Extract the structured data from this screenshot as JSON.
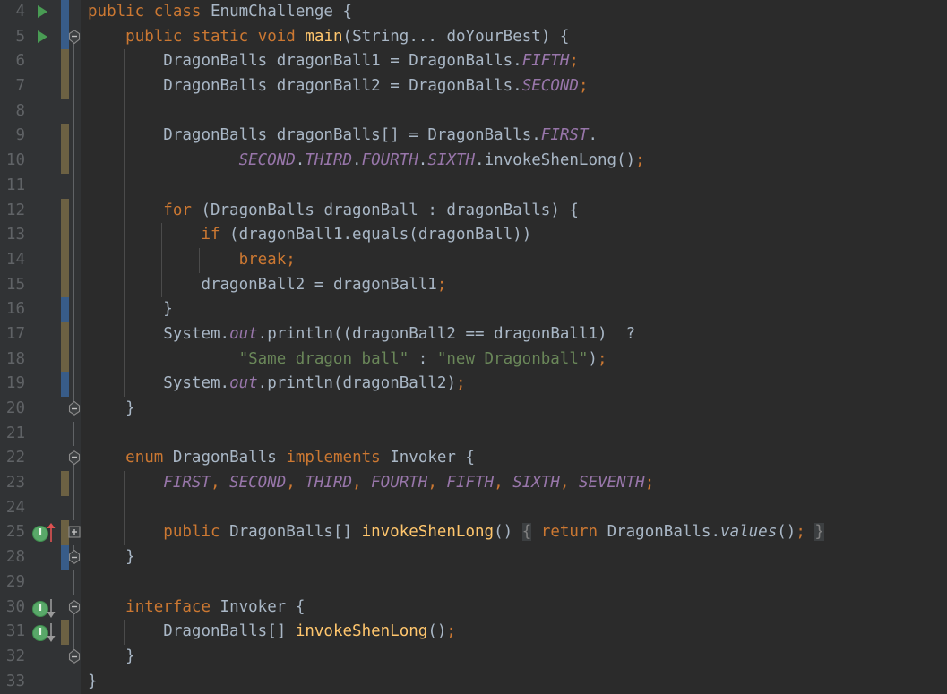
{
  "editor": {
    "app": "intellij-idea-editor",
    "theme": "Darcula",
    "colors": {
      "background": "#2B2B2B",
      "gutter_background": "#313335",
      "line_number": "#606366",
      "keyword": "#CC7832",
      "identifier": "#A9B7C6",
      "method_declaration": "#FFC66D",
      "enum_constant": "#9876AA",
      "string": "#6A8759",
      "vcs_modified": "#6C6143",
      "vcs_added": "#3A6496",
      "run_marker": "#499C54",
      "impl_marker": "#59A869",
      "override_arrow": "#E05252",
      "fold_highlight": "#3C3F41"
    },
    "first_visible_line": 4,
    "last_visible_line": 33
  },
  "lines": [
    {
      "num": "4",
      "indent_guides": [],
      "gutter": {
        "run": true,
        "vcs": "add",
        "fold": "none",
        "impl": "none",
        "arrow": "none"
      },
      "tokens": [
        {
          "t": "public",
          "c": "kw"
        },
        {
          "t": " ",
          "c": "punc"
        },
        {
          "t": "class",
          "c": "kw"
        },
        {
          "t": " ",
          "c": "punc"
        },
        {
          "t": "EnumChallenge",
          "c": "type"
        },
        {
          "t": " ",
          "c": "punc"
        },
        {
          "t": "{",
          "c": "brace"
        }
      ]
    },
    {
      "num": "5",
      "indent_guides": [],
      "gutter": {
        "run": true,
        "vcs": "add",
        "fold": "collapse",
        "impl": "none",
        "arrow": "none"
      },
      "tokens": [
        {
          "t": "    ",
          "c": "punc"
        },
        {
          "t": "public",
          "c": "kw"
        },
        {
          "t": " ",
          "c": "punc"
        },
        {
          "t": "static",
          "c": "kw"
        },
        {
          "t": " ",
          "c": "punc"
        },
        {
          "t": "void",
          "c": "kw"
        },
        {
          "t": " ",
          "c": "punc"
        },
        {
          "t": "main",
          "c": "meth"
        },
        {
          "t": "(",
          "c": "punc"
        },
        {
          "t": "String",
          "c": "type"
        },
        {
          "t": "... ",
          "c": "punc"
        },
        {
          "t": "doYourBest",
          "c": "id"
        },
        {
          "t": ") {",
          "c": "punc"
        }
      ]
    },
    {
      "num": "6",
      "indent_guides": [
        1
      ],
      "gutter": {
        "run": false,
        "vcs": "mod",
        "fold": "line",
        "impl": "none",
        "arrow": "none"
      },
      "tokens": [
        {
          "t": "        ",
          "c": "punc"
        },
        {
          "t": "DragonBalls",
          "c": "type"
        },
        {
          "t": " ",
          "c": "punc"
        },
        {
          "t": "dragonBall1",
          "c": "id"
        },
        {
          "t": " = ",
          "c": "punc"
        },
        {
          "t": "DragonBalls",
          "c": "type"
        },
        {
          "t": ".",
          "c": "punc"
        },
        {
          "t": "FIFTH",
          "c": "enumc"
        },
        {
          "t": ";",
          "c": "orange"
        }
      ]
    },
    {
      "num": "7",
      "indent_guides": [
        1
      ],
      "gutter": {
        "run": false,
        "vcs": "mod",
        "fold": "line",
        "impl": "none",
        "arrow": "none"
      },
      "tokens": [
        {
          "t": "        ",
          "c": "punc"
        },
        {
          "t": "DragonBalls",
          "c": "type"
        },
        {
          "t": " ",
          "c": "punc"
        },
        {
          "t": "dragonBall2",
          "c": "id"
        },
        {
          "t": " = ",
          "c": "punc"
        },
        {
          "t": "DragonBalls",
          "c": "type"
        },
        {
          "t": ".",
          "c": "punc"
        },
        {
          "t": "SECOND",
          "c": "enumc"
        },
        {
          "t": ";",
          "c": "orange"
        }
      ]
    },
    {
      "num": "8",
      "indent_guides": [
        1
      ],
      "gutter": {
        "run": false,
        "vcs": "none",
        "fold": "line",
        "impl": "none",
        "arrow": "none"
      },
      "tokens": []
    },
    {
      "num": "9",
      "indent_guides": [
        1
      ],
      "gutter": {
        "run": false,
        "vcs": "mod",
        "fold": "line",
        "impl": "none",
        "arrow": "none"
      },
      "tokens": [
        {
          "t": "        ",
          "c": "punc"
        },
        {
          "t": "DragonBalls",
          "c": "type"
        },
        {
          "t": " ",
          "c": "punc"
        },
        {
          "t": "dragonBalls",
          "c": "id"
        },
        {
          "t": "[] = ",
          "c": "punc"
        },
        {
          "t": "DragonBalls",
          "c": "type"
        },
        {
          "t": ".",
          "c": "punc"
        },
        {
          "t": "FIRST",
          "c": "enumc"
        },
        {
          "t": ".",
          "c": "punc"
        }
      ]
    },
    {
      "num": "10",
      "indent_guides": [
        1
      ],
      "gutter": {
        "run": false,
        "vcs": "mod",
        "fold": "line",
        "impl": "none",
        "arrow": "none"
      },
      "tokens": [
        {
          "t": "                ",
          "c": "punc"
        },
        {
          "t": "SECOND",
          "c": "enumc"
        },
        {
          "t": ".",
          "c": "punc"
        },
        {
          "t": "THIRD",
          "c": "enumc"
        },
        {
          "t": ".",
          "c": "punc"
        },
        {
          "t": "FOURTH",
          "c": "enumc"
        },
        {
          "t": ".",
          "c": "punc"
        },
        {
          "t": "SIXTH",
          "c": "enumc"
        },
        {
          "t": ".",
          "c": "punc"
        },
        {
          "t": "invokeShenLong",
          "c": "id"
        },
        {
          "t": "()",
          "c": "punc"
        },
        {
          "t": ";",
          "c": "orange"
        }
      ]
    },
    {
      "num": "11",
      "indent_guides": [
        1
      ],
      "gutter": {
        "run": false,
        "vcs": "none",
        "fold": "line",
        "impl": "none",
        "arrow": "none"
      },
      "tokens": []
    },
    {
      "num": "12",
      "indent_guides": [
        1
      ],
      "gutter": {
        "run": false,
        "vcs": "mod",
        "fold": "line",
        "impl": "none",
        "arrow": "none"
      },
      "tokens": [
        {
          "t": "        ",
          "c": "punc"
        },
        {
          "t": "for",
          "c": "kw"
        },
        {
          "t": " (",
          "c": "punc"
        },
        {
          "t": "DragonBalls",
          "c": "type"
        },
        {
          "t": " ",
          "c": "punc"
        },
        {
          "t": "dragonBall",
          "c": "id"
        },
        {
          "t": " : ",
          "c": "punc"
        },
        {
          "t": "dragonBalls",
          "c": "id"
        },
        {
          "t": ") {",
          "c": "punc"
        }
      ]
    },
    {
      "num": "13",
      "indent_guides": [
        1,
        2
      ],
      "gutter": {
        "run": false,
        "vcs": "mod",
        "fold": "line",
        "impl": "none",
        "arrow": "none"
      },
      "tokens": [
        {
          "t": "            ",
          "c": "punc"
        },
        {
          "t": "if",
          "c": "kw"
        },
        {
          "t": " (",
          "c": "punc"
        },
        {
          "t": "dragonBall1",
          "c": "id"
        },
        {
          "t": ".",
          "c": "punc"
        },
        {
          "t": "equals",
          "c": "id"
        },
        {
          "t": "(",
          "c": "punc"
        },
        {
          "t": "dragonBall",
          "c": "id"
        },
        {
          "t": "))",
          "c": "punc"
        }
      ]
    },
    {
      "num": "14",
      "indent_guides": [
        1,
        2,
        3
      ],
      "gutter": {
        "run": false,
        "vcs": "mod",
        "fold": "line",
        "impl": "none",
        "arrow": "none"
      },
      "tokens": [
        {
          "t": "                ",
          "c": "punc"
        },
        {
          "t": "break",
          "c": "kw"
        },
        {
          "t": ";",
          "c": "orange"
        }
      ]
    },
    {
      "num": "15",
      "indent_guides": [
        1,
        2
      ],
      "gutter": {
        "run": false,
        "vcs": "mod",
        "fold": "line",
        "impl": "none",
        "arrow": "none"
      },
      "tokens": [
        {
          "t": "            ",
          "c": "punc"
        },
        {
          "t": "dragonBall2",
          "c": "id"
        },
        {
          "t": " = ",
          "c": "punc"
        },
        {
          "t": "dragonBall1",
          "c": "id"
        },
        {
          "t": ";",
          "c": "orange"
        }
      ]
    },
    {
      "num": "16",
      "indent_guides": [
        1
      ],
      "gutter": {
        "run": false,
        "vcs": "add",
        "fold": "line",
        "impl": "none",
        "arrow": "none"
      },
      "tokens": [
        {
          "t": "        }",
          "c": "punc"
        }
      ]
    },
    {
      "num": "17",
      "indent_guides": [
        1
      ],
      "gutter": {
        "run": false,
        "vcs": "mod",
        "fold": "line",
        "impl": "none",
        "arrow": "none"
      },
      "tokens": [
        {
          "t": "        ",
          "c": "punc"
        },
        {
          "t": "System",
          "c": "type"
        },
        {
          "t": ".",
          "c": "punc"
        },
        {
          "t": "out",
          "c": "field"
        },
        {
          "t": ".",
          "c": "punc"
        },
        {
          "t": "println",
          "c": "id"
        },
        {
          "t": "((",
          "c": "punc"
        },
        {
          "t": "dragonBall2",
          "c": "id"
        },
        {
          "t": " == ",
          "c": "punc"
        },
        {
          "t": "dragonBall1",
          "c": "id"
        },
        {
          "t": ")  ?",
          "c": "punc"
        }
      ]
    },
    {
      "num": "18",
      "indent_guides": [
        1
      ],
      "gutter": {
        "run": false,
        "vcs": "mod",
        "fold": "line",
        "impl": "none",
        "arrow": "none"
      },
      "tokens": [
        {
          "t": "                ",
          "c": "punc"
        },
        {
          "t": "\"Same dragon ball\"",
          "c": "str"
        },
        {
          "t": " : ",
          "c": "punc"
        },
        {
          "t": "\"new Dragonball\"",
          "c": "str"
        },
        {
          "t": ")",
          "c": "punc"
        },
        {
          "t": ";",
          "c": "orange"
        }
      ]
    },
    {
      "num": "19",
      "indent_guides": [
        1
      ],
      "gutter": {
        "run": false,
        "vcs": "add",
        "fold": "line",
        "impl": "none",
        "arrow": "none"
      },
      "tokens": [
        {
          "t": "        ",
          "c": "punc"
        },
        {
          "t": "System",
          "c": "type"
        },
        {
          "t": ".",
          "c": "punc"
        },
        {
          "t": "out",
          "c": "field"
        },
        {
          "t": ".",
          "c": "punc"
        },
        {
          "t": "println",
          "c": "id"
        },
        {
          "t": "(",
          "c": "punc"
        },
        {
          "t": "dragonBall2",
          "c": "id"
        },
        {
          "t": ")",
          "c": "punc"
        },
        {
          "t": ";",
          "c": "orange"
        }
      ]
    },
    {
      "num": "20",
      "indent_guides": [],
      "gutter": {
        "run": false,
        "vcs": "none",
        "fold": "end",
        "impl": "none",
        "arrow": "none"
      },
      "tokens": [
        {
          "t": "    }",
          "c": "punc"
        }
      ]
    },
    {
      "num": "21",
      "indent_guides": [],
      "gutter": {
        "run": false,
        "vcs": "none",
        "fold": "line",
        "impl": "none",
        "arrow": "none"
      },
      "tokens": []
    },
    {
      "num": "22",
      "indent_guides": [],
      "gutter": {
        "run": false,
        "vcs": "none",
        "fold": "collapse",
        "impl": "none",
        "arrow": "none"
      },
      "tokens": [
        {
          "t": "    ",
          "c": "punc"
        },
        {
          "t": "enum",
          "c": "kw"
        },
        {
          "t": " ",
          "c": "punc"
        },
        {
          "t": "DragonBalls",
          "c": "type"
        },
        {
          "t": " ",
          "c": "punc"
        },
        {
          "t": "implements",
          "c": "kw"
        },
        {
          "t": " ",
          "c": "punc"
        },
        {
          "t": "Invoker",
          "c": "type"
        },
        {
          "t": " {",
          "c": "punc"
        }
      ]
    },
    {
      "num": "23",
      "indent_guides": [
        1
      ],
      "gutter": {
        "run": false,
        "vcs": "mod",
        "fold": "line",
        "impl": "none",
        "arrow": "none"
      },
      "tokens": [
        {
          "t": "        ",
          "c": "punc"
        },
        {
          "t": "FIRST",
          "c": "enumc"
        },
        {
          "t": ", ",
          "c": "orange"
        },
        {
          "t": "SECOND",
          "c": "enumc"
        },
        {
          "t": ", ",
          "c": "orange"
        },
        {
          "t": "THIRD",
          "c": "enumc"
        },
        {
          "t": ", ",
          "c": "orange"
        },
        {
          "t": "FOURTH",
          "c": "enumc"
        },
        {
          "t": ", ",
          "c": "orange"
        },
        {
          "t": "FIFTH",
          "c": "enumc"
        },
        {
          "t": ", ",
          "c": "orange"
        },
        {
          "t": "SIXTH",
          "c": "enumc"
        },
        {
          "t": ", ",
          "c": "orange"
        },
        {
          "t": "SEVENTH",
          "c": "enumc"
        },
        {
          "t": ";",
          "c": "orange"
        }
      ]
    },
    {
      "num": "24",
      "indent_guides": [
        1
      ],
      "gutter": {
        "run": false,
        "vcs": "none",
        "fold": "line",
        "impl": "none",
        "arrow": "none"
      },
      "tokens": []
    },
    {
      "num": "25",
      "indent_guides": [
        1
      ],
      "gutter": {
        "run": false,
        "vcs": "mod",
        "fold": "expand",
        "impl": "green-i",
        "arrow": "up-red"
      },
      "tokens": [
        {
          "t": "        ",
          "c": "punc"
        },
        {
          "t": "public",
          "c": "kw"
        },
        {
          "t": " ",
          "c": "punc"
        },
        {
          "t": "DragonBalls",
          "c": "type"
        },
        {
          "t": "[] ",
          "c": "punc"
        },
        {
          "t": "invokeShenLong",
          "c": "meth"
        },
        {
          "t": "()",
          "c": "punc"
        },
        {
          "t": " ",
          "c": "punc"
        },
        {
          "t": "{",
          "c": "foldbg"
        },
        {
          "t": " ",
          "c": "punc"
        },
        {
          "t": "return",
          "c": "kw"
        },
        {
          "t": " ",
          "c": "punc"
        },
        {
          "t": "DragonBalls",
          "c": "type"
        },
        {
          "t": ".",
          "c": "punc"
        },
        {
          "t": "values",
          "c": "statm"
        },
        {
          "t": "()",
          "c": "punc"
        },
        {
          "t": ";",
          "c": "orange"
        },
        {
          "t": " ",
          "c": "punc"
        },
        {
          "t": "}",
          "c": "foldbg"
        }
      ]
    },
    {
      "num": "28",
      "indent_guides": [],
      "gutter": {
        "run": false,
        "vcs": "add",
        "fold": "end",
        "impl": "none",
        "arrow": "none"
      },
      "tokens": [
        {
          "t": "    }",
          "c": "punc"
        }
      ]
    },
    {
      "num": "29",
      "indent_guides": [],
      "gutter": {
        "run": false,
        "vcs": "none",
        "fold": "line",
        "impl": "none",
        "arrow": "none"
      },
      "tokens": []
    },
    {
      "num": "30",
      "indent_guides": [],
      "gutter": {
        "run": false,
        "vcs": "none",
        "fold": "collapse",
        "impl": "green-i",
        "arrow": "down-gray"
      },
      "tokens": [
        {
          "t": "    ",
          "c": "punc"
        },
        {
          "t": "interface",
          "c": "kw"
        },
        {
          "t": " ",
          "c": "punc"
        },
        {
          "t": "Invoker",
          "c": "type"
        },
        {
          "t": " {",
          "c": "punc"
        }
      ]
    },
    {
      "num": "31",
      "indent_guides": [
        1
      ],
      "gutter": {
        "run": false,
        "vcs": "mod",
        "fold": "line",
        "impl": "green-i",
        "arrow": "down-gray"
      },
      "tokens": [
        {
          "t": "        ",
          "c": "punc"
        },
        {
          "t": "DragonBalls",
          "c": "type"
        },
        {
          "t": "[] ",
          "c": "punc"
        },
        {
          "t": "invokeShenLong",
          "c": "meth"
        },
        {
          "t": "()",
          "c": "punc"
        },
        {
          "t": ";",
          "c": "orange"
        }
      ]
    },
    {
      "num": "32",
      "indent_guides": [],
      "gutter": {
        "run": false,
        "vcs": "none",
        "fold": "end",
        "impl": "none",
        "arrow": "none"
      },
      "tokens": [
        {
          "t": "    }",
          "c": "punc"
        }
      ]
    },
    {
      "num": "33",
      "indent_guides": [],
      "gutter": {
        "run": false,
        "vcs": "none",
        "fold": "none",
        "impl": "none",
        "arrow": "none"
      },
      "tokens": [
        {
          "t": "}",
          "c": "punc"
        }
      ]
    }
  ]
}
